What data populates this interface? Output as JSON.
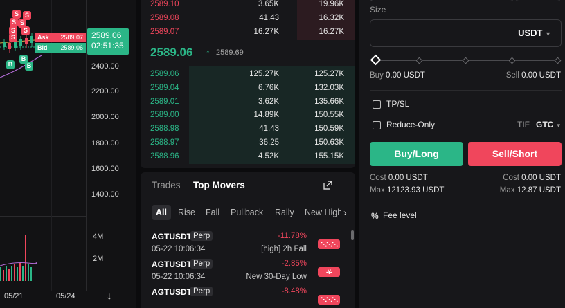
{
  "chart": {
    "y_ticks": [
      "2400.00",
      "2200.00",
      "2000.00",
      "1800.00",
      "1600.00",
      "1400.00"
    ],
    "volume_ticks": [
      "4M",
      "2M"
    ],
    "x_ticks": [
      "05/21",
      "05/24"
    ],
    "ask_label": "Ask",
    "ask_value": "2589.07",
    "bid_label": "Bid",
    "bid_value": "2589.06",
    "last_price": "2589.06",
    "countdown": "02:51:35",
    "sell_marker": "S",
    "buy_marker": "B",
    "colors": {
      "up": "#2bb687",
      "down": "#f0465c"
    }
  },
  "orderbook": {
    "asks": [
      {
        "price": "2589.10",
        "size": "3.65K",
        "total": "19.96K"
      },
      {
        "price": "2589.08",
        "size": "41.43",
        "total": "16.32K"
      },
      {
        "price": "2589.07",
        "size": "16.27K",
        "total": "16.27K"
      }
    ],
    "mid_price": "2589.06",
    "mid_arrow": "↑",
    "mark_price": "2589.69",
    "bids": [
      {
        "price": "2589.06",
        "size": "125.27K",
        "total": "125.27K"
      },
      {
        "price": "2589.04",
        "size": "6.76K",
        "total": "132.03K"
      },
      {
        "price": "2589.01",
        "size": "3.62K",
        "total": "135.66K"
      },
      {
        "price": "2589.00",
        "size": "14.89K",
        "total": "150.55K"
      },
      {
        "price": "2588.98",
        "size": "41.43",
        "total": "150.59K"
      },
      {
        "price": "2588.97",
        "size": "36.25",
        "total": "150.63K"
      },
      {
        "price": "2588.96",
        "size": "4.52K",
        "total": "155.15K"
      }
    ]
  },
  "movers": {
    "tabs": {
      "trades": "Trades",
      "top_movers": "Top Movers"
    },
    "filters": [
      "All",
      "Rise",
      "Fall",
      "Pullback",
      "Rally",
      "New High"
    ],
    "items": [
      {
        "symbol": "AGTUSDT",
        "badge": "Perp",
        "time": "05-22 10:06:34",
        "pct": "-11.78%",
        "desc": "[high] 2h Fall",
        "icon": "fall-icon"
      },
      {
        "symbol": "AGTUSDT",
        "badge": "Perp",
        "time": "05-22 10:06:34",
        "pct": "-2.85%",
        "desc": "New 30-Day Low",
        "icon": "new-low-icon"
      },
      {
        "symbol": "AGTUSDT",
        "badge": "Perp",
        "time": "",
        "pct": "-8.48%",
        "desc": "",
        "icon": "fall-icon"
      }
    ]
  },
  "form": {
    "size_label": "Size",
    "size_unit": "USDT",
    "slider_percent": 0,
    "buy_label": "Buy",
    "buy_value": "0.00 USDT",
    "sell_label": "Sell",
    "sell_value": "0.00 USDT",
    "tpsl_label": "TP/SL",
    "reduce_only_label": "Reduce-Only",
    "tif_label": "TIF",
    "tif_value": "GTC",
    "buy_button": "Buy/Long",
    "sell_button": "Sell/Short",
    "cost_label": "Cost",
    "cost_long": "0.00 USDT",
    "cost_short": "0.00 USDT",
    "max_label": "Max",
    "max_long": "12123.93 USDT",
    "max_short": "12.87 USDT",
    "fee_label": "Fee level"
  }
}
